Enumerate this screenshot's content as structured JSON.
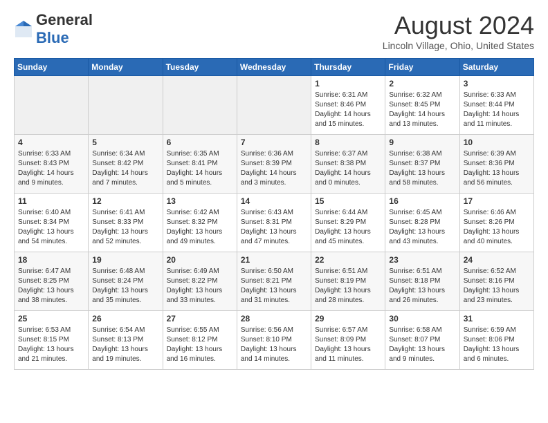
{
  "header": {
    "logo_general": "General",
    "logo_blue": "Blue",
    "month_title": "August 2024",
    "location": "Lincoln Village, Ohio, United States"
  },
  "days_of_week": [
    "Sunday",
    "Monday",
    "Tuesday",
    "Wednesday",
    "Thursday",
    "Friday",
    "Saturday"
  ],
  "weeks": [
    [
      {
        "day": "",
        "info": ""
      },
      {
        "day": "",
        "info": ""
      },
      {
        "day": "",
        "info": ""
      },
      {
        "day": "",
        "info": ""
      },
      {
        "day": "1",
        "info": "Sunrise: 6:31 AM\nSunset: 8:46 PM\nDaylight: 14 hours and 15 minutes."
      },
      {
        "day": "2",
        "info": "Sunrise: 6:32 AM\nSunset: 8:45 PM\nDaylight: 14 hours and 13 minutes."
      },
      {
        "day": "3",
        "info": "Sunrise: 6:33 AM\nSunset: 8:44 PM\nDaylight: 14 hours and 11 minutes."
      }
    ],
    [
      {
        "day": "4",
        "info": "Sunrise: 6:33 AM\nSunset: 8:43 PM\nDaylight: 14 hours and 9 minutes."
      },
      {
        "day": "5",
        "info": "Sunrise: 6:34 AM\nSunset: 8:42 PM\nDaylight: 14 hours and 7 minutes."
      },
      {
        "day": "6",
        "info": "Sunrise: 6:35 AM\nSunset: 8:41 PM\nDaylight: 14 hours and 5 minutes."
      },
      {
        "day": "7",
        "info": "Sunrise: 6:36 AM\nSunset: 8:39 PM\nDaylight: 14 hours and 3 minutes."
      },
      {
        "day": "8",
        "info": "Sunrise: 6:37 AM\nSunset: 8:38 PM\nDaylight: 14 hours and 0 minutes."
      },
      {
        "day": "9",
        "info": "Sunrise: 6:38 AM\nSunset: 8:37 PM\nDaylight: 13 hours and 58 minutes."
      },
      {
        "day": "10",
        "info": "Sunrise: 6:39 AM\nSunset: 8:36 PM\nDaylight: 13 hours and 56 minutes."
      }
    ],
    [
      {
        "day": "11",
        "info": "Sunrise: 6:40 AM\nSunset: 8:34 PM\nDaylight: 13 hours and 54 minutes."
      },
      {
        "day": "12",
        "info": "Sunrise: 6:41 AM\nSunset: 8:33 PM\nDaylight: 13 hours and 52 minutes."
      },
      {
        "day": "13",
        "info": "Sunrise: 6:42 AM\nSunset: 8:32 PM\nDaylight: 13 hours and 49 minutes."
      },
      {
        "day": "14",
        "info": "Sunrise: 6:43 AM\nSunset: 8:31 PM\nDaylight: 13 hours and 47 minutes."
      },
      {
        "day": "15",
        "info": "Sunrise: 6:44 AM\nSunset: 8:29 PM\nDaylight: 13 hours and 45 minutes."
      },
      {
        "day": "16",
        "info": "Sunrise: 6:45 AM\nSunset: 8:28 PM\nDaylight: 13 hours and 43 minutes."
      },
      {
        "day": "17",
        "info": "Sunrise: 6:46 AM\nSunset: 8:26 PM\nDaylight: 13 hours and 40 minutes."
      }
    ],
    [
      {
        "day": "18",
        "info": "Sunrise: 6:47 AM\nSunset: 8:25 PM\nDaylight: 13 hours and 38 minutes."
      },
      {
        "day": "19",
        "info": "Sunrise: 6:48 AM\nSunset: 8:24 PM\nDaylight: 13 hours and 35 minutes."
      },
      {
        "day": "20",
        "info": "Sunrise: 6:49 AM\nSunset: 8:22 PM\nDaylight: 13 hours and 33 minutes."
      },
      {
        "day": "21",
        "info": "Sunrise: 6:50 AM\nSunset: 8:21 PM\nDaylight: 13 hours and 31 minutes."
      },
      {
        "day": "22",
        "info": "Sunrise: 6:51 AM\nSunset: 8:19 PM\nDaylight: 13 hours and 28 minutes."
      },
      {
        "day": "23",
        "info": "Sunrise: 6:51 AM\nSunset: 8:18 PM\nDaylight: 13 hours and 26 minutes."
      },
      {
        "day": "24",
        "info": "Sunrise: 6:52 AM\nSunset: 8:16 PM\nDaylight: 13 hours and 23 minutes."
      }
    ],
    [
      {
        "day": "25",
        "info": "Sunrise: 6:53 AM\nSunset: 8:15 PM\nDaylight: 13 hours and 21 minutes."
      },
      {
        "day": "26",
        "info": "Sunrise: 6:54 AM\nSunset: 8:13 PM\nDaylight: 13 hours and 19 minutes."
      },
      {
        "day": "27",
        "info": "Sunrise: 6:55 AM\nSunset: 8:12 PM\nDaylight: 13 hours and 16 minutes."
      },
      {
        "day": "28",
        "info": "Sunrise: 6:56 AM\nSunset: 8:10 PM\nDaylight: 13 hours and 14 minutes."
      },
      {
        "day": "29",
        "info": "Sunrise: 6:57 AM\nSunset: 8:09 PM\nDaylight: 13 hours and 11 minutes."
      },
      {
        "day": "30",
        "info": "Sunrise: 6:58 AM\nSunset: 8:07 PM\nDaylight: 13 hours and 9 minutes."
      },
      {
        "day": "31",
        "info": "Sunrise: 6:59 AM\nSunset: 8:06 PM\nDaylight: 13 hours and 6 minutes."
      }
    ]
  ]
}
